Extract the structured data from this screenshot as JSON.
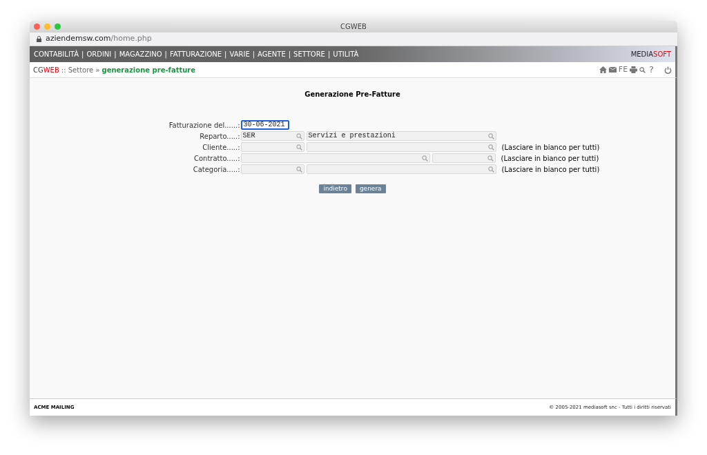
{
  "window": {
    "title": "CGWEB",
    "url_host": "aziendemsw.com",
    "url_path": "/home.php"
  },
  "menu": {
    "separator": "|",
    "items": [
      "CONTABILITÀ",
      "ORDINI",
      "MAGAZZINO",
      "FATTURAZIONE",
      "VARIE",
      "AGENTE",
      "SETTORE",
      "UTILITÀ"
    ],
    "brand": [
      "MEDIA",
      "SOFT"
    ]
  },
  "breadcrumb": {
    "logo": [
      "CG",
      "WEB"
    ],
    "path": ":: Settore »",
    "current": "generazione pre-fatture"
  },
  "toolbar": {
    "fe_label": "FE",
    "help_label": "?"
  },
  "form": {
    "title": "Generazione Pre-Fatture",
    "rows": [
      {
        "label": "Fatturazione del......:",
        "fields": [
          {
            "kind": "date",
            "value": "30-06-2021",
            "focused": true
          }
        ]
      },
      {
        "label": "Reparto.....:",
        "fields": [
          {
            "kind": "code",
            "value": "SER",
            "focused": false
          },
          {
            "kind": "desc",
            "value": "Servizi e prestazioni",
            "focused": false
          }
        ]
      },
      {
        "label": "Cliente.....:",
        "fields": [
          {
            "kind": "code",
            "focused": false
          },
          {
            "kind": "desc",
            "focused": false
          }
        ],
        "note": "(Lasciare in bianco per tutti)"
      },
      {
        "label": "Contratto.....:",
        "fields": [
          {
            "kind": "wide",
            "focused": false
          },
          {
            "kind": "small",
            "focused": false
          }
        ],
        "note": "(Lasciare in bianco per tutti)"
      },
      {
        "label": "Categoria.....:",
        "fields": [
          {
            "kind": "code",
            "focused": false
          },
          {
            "kind": "desc",
            "focused": false
          }
        ],
        "note": "(Lasciare in bianco per tutti)"
      }
    ],
    "buttons": [
      "indietro",
      "genera"
    ]
  },
  "footer": {
    "company": "ACME MAILING",
    "copyright": "© 2005-2021 mediasoft snc - Tutti i diritti riservati"
  }
}
